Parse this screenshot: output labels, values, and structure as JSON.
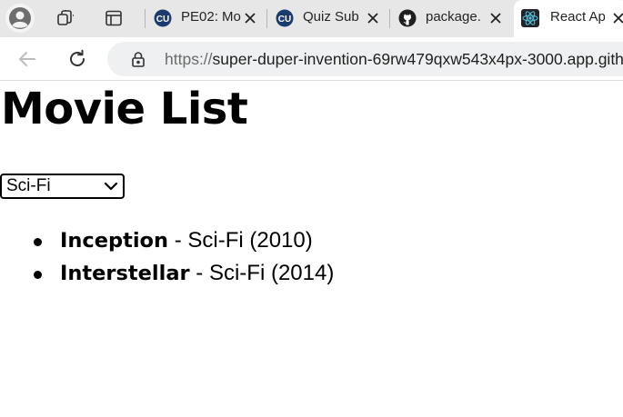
{
  "browser": {
    "tabs": [
      {
        "title": "PE02: Mo",
        "favicon": "cu-logo-icon",
        "active": false
      },
      {
        "title": "Quiz Sub",
        "favicon": "cu-logo-icon",
        "active": false
      },
      {
        "title": "package.",
        "favicon": "github-icon",
        "active": false
      },
      {
        "title": "React Ap",
        "favicon": "react-icon",
        "active": true
      }
    ],
    "address_bar": {
      "scheme": "https://",
      "host": "super-duper-invention-69rw479qxw543x4px-3000.app.gith"
    },
    "icons": {
      "profile": "profile-icon",
      "collections": "collections-icon",
      "vertical_tabs": "vertical-tabs-icon",
      "back": "back-arrow-icon",
      "reload": "reload-icon",
      "lock": "lock-icon",
      "close": "close-icon"
    }
  },
  "page": {
    "title": "Movie List",
    "genre_select": {
      "selected": "Sci-Fi"
    },
    "movies": [
      {
        "title": "Inception",
        "detail": " - Sci-Fi (2010)"
      },
      {
        "title": "Interstellar",
        "detail": " - Sci-Fi (2014)"
      }
    ]
  },
  "colors": {
    "tabstrip_bg": "#e7e7e7",
    "omnibox_bg": "#eff0f1",
    "cu_badge": "#1b3b6f",
    "react_cyan": "#58c4dc"
  }
}
